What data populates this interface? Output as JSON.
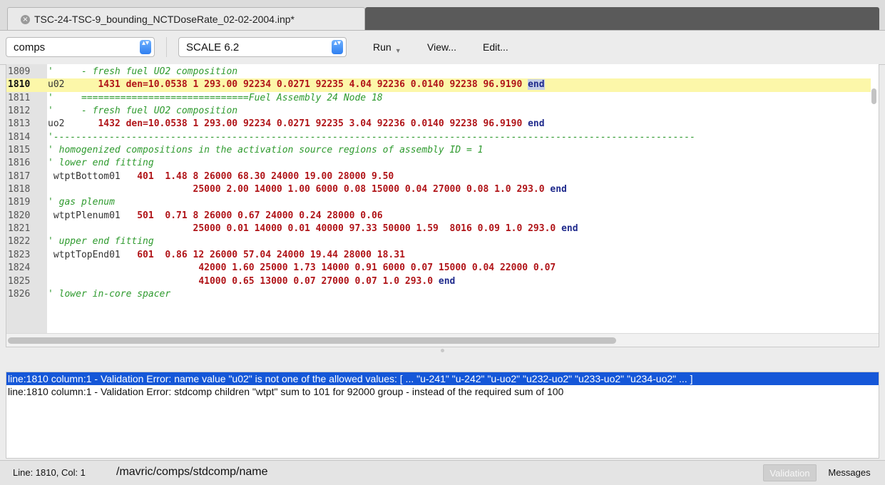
{
  "tab": {
    "title": "TSC-24-TSC-9_bounding_NCTDoseRate_02-02-2004.inp*",
    "close_glyph": "×"
  },
  "toolbar": {
    "component_select": "comps",
    "version_select": "SCALE 6.2",
    "run_label": "Run",
    "view_label": "View...",
    "edit_label": "Edit...",
    "stepper_glyph": "▴▾"
  },
  "editor": {
    "current_line": 1810,
    "lines": [
      {
        "n": "1809",
        "parts": [
          {
            "t": "' ",
            "c": "c"
          },
          {
            "t": "    - fresh fuel UO2 composition",
            "c": "c"
          }
        ]
      },
      {
        "n": "1810",
        "hl": true,
        "parts": [
          {
            "t": "u02",
            "c": "kw"
          },
          {
            "t": "      1431 den=10.0538 1 293.00 92234 0.0271 92235 4.04 92236 0.0140 92238 96.9190 ",
            "c": "num"
          },
          {
            "t": "end",
            "c": "end sel"
          }
        ]
      },
      {
        "n": "1811",
        "parts": [
          {
            "t": "' ",
            "c": "c"
          },
          {
            "t": "    ==============================Fuel Assembly 24 Node 18",
            "c": "c"
          }
        ]
      },
      {
        "n": "1812",
        "parts": [
          {
            "t": "' ",
            "c": "c"
          },
          {
            "t": "    - fresh fuel UO2 composition",
            "c": "c"
          }
        ]
      },
      {
        "n": "1813",
        "parts": [
          {
            "t": "uo2",
            "c": "kw"
          },
          {
            "t": "      1432 den=10.0538 1 293.00 92234 0.0271 92235 3.04 92236 0.0140 92238 96.9190 ",
            "c": "num"
          },
          {
            "t": "end",
            "c": "end"
          }
        ]
      },
      {
        "n": "1814",
        "parts": [
          {
            "t": "'-------------------------------------------------------------------------------------------------------------------",
            "c": "c"
          }
        ]
      },
      {
        "n": "1815",
        "parts": [
          {
            "t": "' homogenized compositions in the activation source regions of assembly ID = 1",
            "c": "c"
          }
        ]
      },
      {
        "n": "1816",
        "parts": [
          {
            "t": "' lower end fitting",
            "c": "c"
          }
        ]
      },
      {
        "n": "1817",
        "parts": [
          {
            "t": " wtptBottom01   ",
            "c": "kw"
          },
          {
            "t": "401  1.48 8 26000 68.30 24000 19.00 28000 9.50",
            "c": "num"
          }
        ]
      },
      {
        "n": "1818",
        "parts": [
          {
            "t": "                          25000 2.00 14000 1.00 6000 0.08 15000 0.04 27000 0.08 1.0 293.0 ",
            "c": "num"
          },
          {
            "t": "end",
            "c": "end"
          }
        ]
      },
      {
        "n": "1819",
        "parts": [
          {
            "t": "' gas plenum",
            "c": "c"
          }
        ]
      },
      {
        "n": "1820",
        "parts": [
          {
            "t": " wtptPlenum01   ",
            "c": "kw"
          },
          {
            "t": "501  0.71 8 26000 0.67 24000 0.24 28000 0.06",
            "c": "num"
          }
        ]
      },
      {
        "n": "1821",
        "parts": [
          {
            "t": "                          25000 0.01 14000 0.01 40000 97.33 50000 1.59  8016 0.09 1.0 293.0 ",
            "c": "num"
          },
          {
            "t": "end",
            "c": "end"
          }
        ]
      },
      {
        "n": "1822",
        "parts": [
          {
            "t": "' upper end fitting",
            "c": "c"
          }
        ]
      },
      {
        "n": "1823",
        "parts": [
          {
            "t": " wtptTopEnd01   ",
            "c": "kw"
          },
          {
            "t": "601  0.86 12 26000 57.04 24000 19.44 28000 18.31",
            "c": "num"
          }
        ]
      },
      {
        "n": "1824",
        "parts": [
          {
            "t": "                           42000 1.60 25000 1.73 14000 0.91 6000 0.07 15000 0.04 22000 0.07",
            "c": "num"
          }
        ]
      },
      {
        "n": "1825",
        "parts": [
          {
            "t": "                           41000 0.65 13000 0.07 27000 0.07 1.0 293.0 ",
            "c": "num"
          },
          {
            "t": "end",
            "c": "end"
          }
        ]
      },
      {
        "n": "1826",
        "parts": [
          {
            "t": "' lower in-core spacer",
            "c": "c"
          }
        ]
      }
    ]
  },
  "messages": [
    {
      "text": "line:1810 column:1 - Validation Error: name value \"u02\" is not one of the allowed values: [ ... \"u-241\" \"u-242\" \"u-uo2\" \"u232-uo2\" \"u233-uo2\" \"u234-uo2\" ... ]",
      "selected": true
    },
    {
      "text": "line:1810 column:1 - Validation Error: stdcomp children \"wtpt\" sum to 101 for 92000 group - instead of the required sum of 100",
      "selected": false
    }
  ],
  "status": {
    "position": "Line: 1810, Col: 1",
    "path": "/mavric/comps/stdcomp/name",
    "validation_label": "Validation",
    "messages_label": "Messages"
  },
  "colors": {
    "selection_blue": "#1557d8",
    "current_line": "#fcf7a9",
    "number_red": "#b01418",
    "comment_green": "#2e9a2e",
    "keyword_end": "#1f2a8c"
  }
}
